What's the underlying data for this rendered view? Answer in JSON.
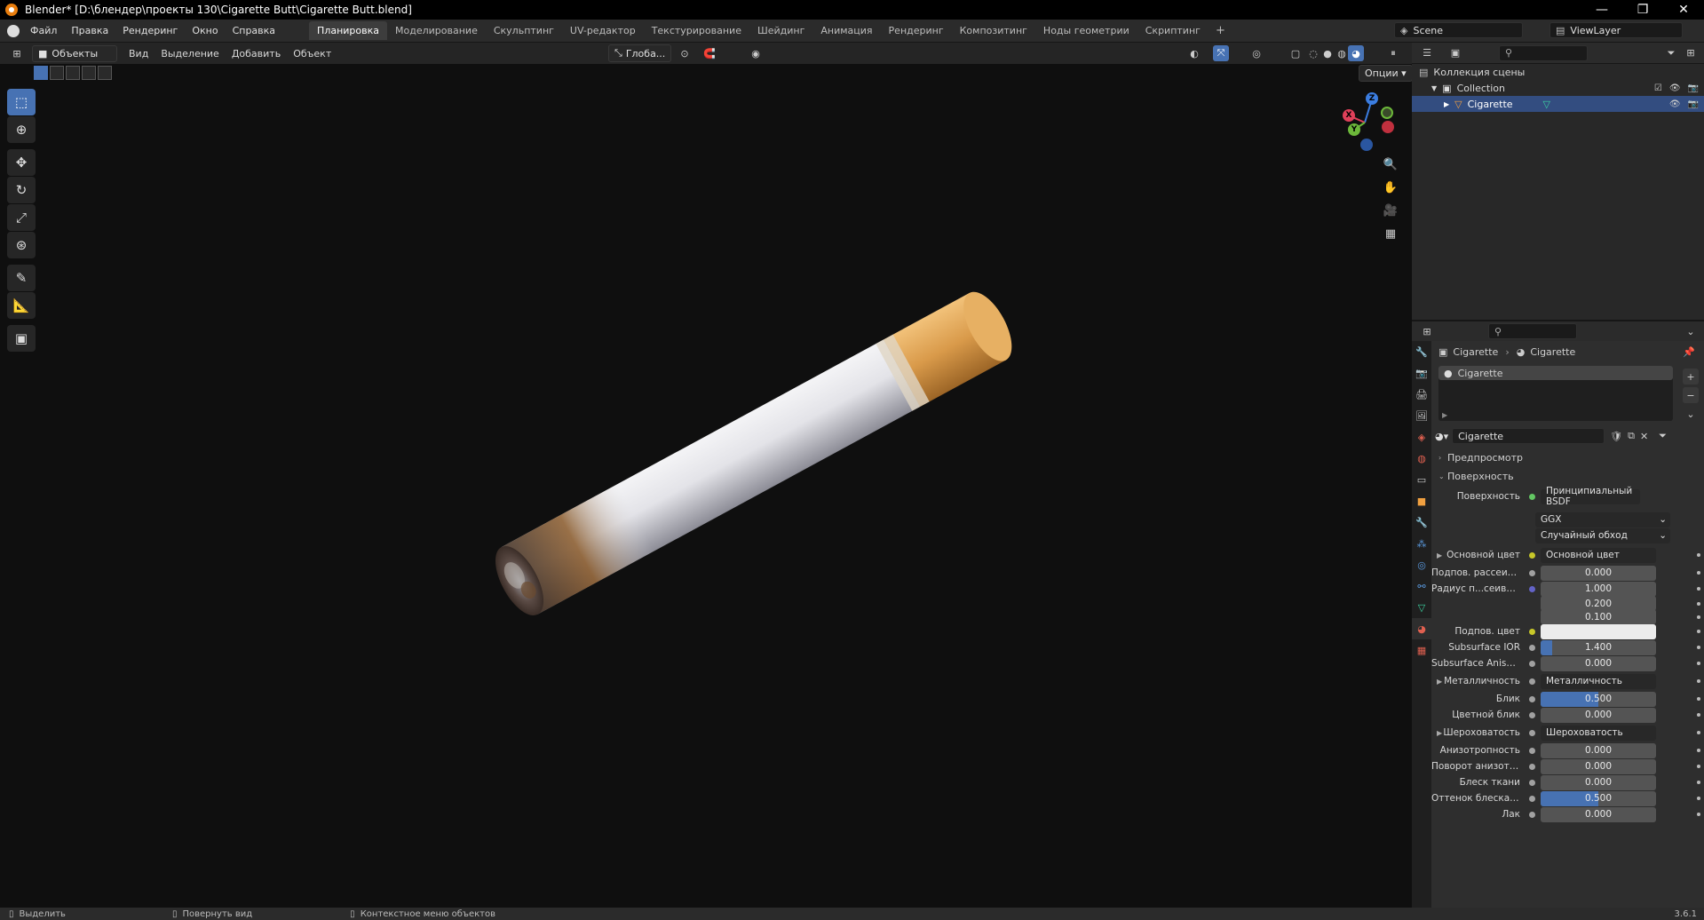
{
  "titlebar": {
    "title": "Blender* [D:\\блендер\\проекты 130\\Cigarette Butt\\Cigarette Butt.blend]"
  },
  "menubar": {
    "menus": [
      "Файл",
      "Правка",
      "Рендеринг",
      "Окно",
      "Справка"
    ],
    "workspaces": [
      "Планировка",
      "Моделирование",
      "Скульптинг",
      "UV-редактор",
      "Текстурирование",
      "Шейдинг",
      "Анимация",
      "Рендеринг",
      "Композитинг",
      "Ноды геометрии",
      "Скриптинг"
    ],
    "active_workspace": "Планировка",
    "add_tab": "+",
    "scene": "Scene",
    "view_layer": "ViewLayer"
  },
  "viewport_header": {
    "mode": "Объекты",
    "menus": [
      "Вид",
      "Выделение",
      "Добавить",
      "Объект"
    ],
    "orientation": "Глоба...",
    "options": "Опции"
  },
  "gizmo": {
    "x": "X",
    "y": "Y",
    "z": "Z"
  },
  "outliner": {
    "scene_collection": "Коллекция сцены",
    "collection": "Collection",
    "object": "Cigarette"
  },
  "properties": {
    "breadcrumb_object": "Cigarette",
    "breadcrumb_material": "Cigarette",
    "slot": "Cigarette",
    "material_name": "Cigarette",
    "panel_preview": "Предпросмотр",
    "panel_surface": "Поверхность",
    "surface_label": "Поверхность",
    "surface_value": "Принципиальный BSDF",
    "distribution": "GGX",
    "subsurface_method": "Случайный обход",
    "rows": [
      {
        "label": "Основной цвет",
        "type": "link",
        "value": "Основной цвет",
        "sock": "#c7c729",
        "exp": true
      },
      {
        "label": "Подпов. рассеива...",
        "type": "num",
        "value": "0.000",
        "sock": "#a1a1a1",
        "fill": 0
      },
      {
        "label": "Радиус п...сеивания",
        "type": "num",
        "value": "1.000",
        "sock": "#6363c7",
        "fill": 0
      },
      {
        "label": "",
        "type": "num",
        "value": "0.200",
        "sock": "",
        "fill": 0
      },
      {
        "label": "",
        "type": "num",
        "value": "0.100",
        "sock": "",
        "fill": 0
      },
      {
        "label": "Подпов. цвет",
        "type": "color",
        "value": "",
        "sock": "#c7c729",
        "color": "#ececec"
      },
      {
        "label": "Subsurface IOR",
        "type": "num",
        "value": "1.400",
        "sock": "#a1a1a1",
        "fill": 0.1
      },
      {
        "label": "Subsurface Anisotr...",
        "type": "num",
        "value": "0.000",
        "sock": "#a1a1a1",
        "fill": 0
      },
      {
        "label": "Металличность",
        "type": "link",
        "value": "Металличность",
        "sock": "#a1a1a1",
        "exp": true
      },
      {
        "label": "Блик",
        "type": "num",
        "value": "0.500",
        "sock": "#a1a1a1",
        "fill": 0.5
      },
      {
        "label": "Цветной блик",
        "type": "num",
        "value": "0.000",
        "sock": "#a1a1a1",
        "fill": 0
      },
      {
        "label": "Шероховатость",
        "type": "link",
        "value": "Шероховатость",
        "sock": "#a1a1a1",
        "exp": true
      },
      {
        "label": "Анизотропность",
        "type": "num",
        "value": "0.000",
        "sock": "#a1a1a1",
        "fill": 0
      },
      {
        "label": "Поворот анизотро...",
        "type": "num",
        "value": "0.000",
        "sock": "#a1a1a1",
        "fill": 0
      },
      {
        "label": "Блеск ткани",
        "type": "num",
        "value": "0.000",
        "sock": "#a1a1a1",
        "fill": 0
      },
      {
        "label": "Оттенок блеска тк...",
        "type": "num",
        "value": "0.500",
        "sock": "#a1a1a1",
        "fill": 0.5
      },
      {
        "label": "Лак",
        "type": "num",
        "value": "0.000",
        "sock": "#a1a1a1",
        "fill": 0
      }
    ]
  },
  "statusbar": {
    "select": "Выделить",
    "rotate": "Повернуть вид",
    "context": "Контекстное меню объектов",
    "version": "3.6.1"
  },
  "colors": {
    "accent": "#4772b3",
    "selected_row": "#334d80",
    "blender_orange": "#e87d0d"
  }
}
